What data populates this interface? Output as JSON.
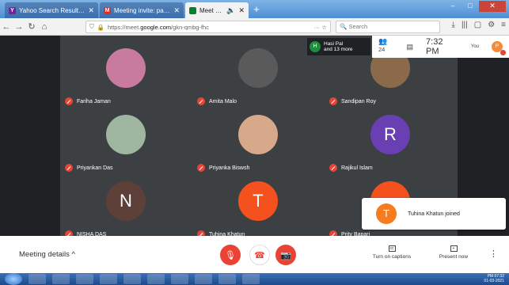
{
  "browser": {
    "tabs": [
      {
        "title": "Yahoo Search Results - Web se",
        "favicon": "Y",
        "color": "#7b1fa2"
      },
      {
        "title": "Meeting invite: paban ghosh is",
        "favicon": "M",
        "color": "#d93025"
      },
      {
        "title": "Meet - gkn-qmbg-fhc",
        "favicon": "",
        "color": "#00832d"
      }
    ],
    "url_prefix": "https://meet.",
    "url_domain": "google.com",
    "url_path": "/gkn-qmbg-fhc",
    "search_placeholder": "Search"
  },
  "meet": {
    "participants_badge": "H",
    "participants_name": "Hasi Pal",
    "participants_more": "and 13 more",
    "participant_count": "24",
    "time": "7:32 PM",
    "you_label": "You",
    "user_initial": "P",
    "tiles": [
      {
        "name": "Fariha Jaman",
        "initial": "",
        "color": "#c97a9f"
      },
      {
        "name": "Amita Malo",
        "initial": "",
        "color": "#5a5a5a"
      },
      {
        "name": "Sandipan Roy",
        "initial": "",
        "color": "#8a6a4a"
      },
      {
        "name": "Priyankan Das",
        "initial": "",
        "color": "#9fb7a0"
      },
      {
        "name": "Priyanka Biswsh",
        "initial": "",
        "color": "#d7a88a"
      },
      {
        "name": "Rajikul Islam",
        "initial": "R",
        "color": "#6a3fb3"
      },
      {
        "name": "NISHA DAS",
        "initial": "N",
        "color": "#5d4037"
      },
      {
        "name": "Tuhina Khatun",
        "initial": "T",
        "color": "#f4511e"
      },
      {
        "name": "Prity Bapari",
        "initial": "",
        "color": "#f4511e"
      }
    ],
    "toast_initial": "T",
    "toast_text": "Tuhina Khatun joined"
  },
  "controls": {
    "meeting_details": "Meeting details",
    "captions_label": "Turn on captions",
    "present_label": "Present now"
  },
  "taskbar": {
    "time": "PM 07:32",
    "date": "01-03-2021"
  }
}
